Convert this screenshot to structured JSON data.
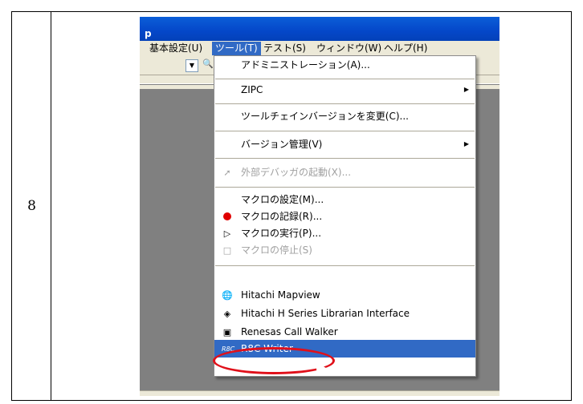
{
  "step_number": "8",
  "window": {
    "title_fragment": "p"
  },
  "menubar": [
    "基本設定(U)",
    "ツール(T)",
    "テスト(S)",
    "ウィンドウ(W)",
    "ヘルプ(H)"
  ],
  "tools_menu": {
    "administration": "アドミニストレーション(A)...",
    "zipc": "ZIPC",
    "toolchain": "ツールチェインバージョンを変更(C)...",
    "version_control": "バージョン管理(V)",
    "external_debugger": "外部デバッガの起動(X)...",
    "macro_settings": "マクロの設定(M)...",
    "macro_record": "マクロの記録(R)...",
    "macro_run": "マクロの実行(P)...",
    "macro_stop": "マクロの停止(S)",
    "hitachi_mapview": "Hitachi Mapview",
    "hitachi_librarian": "Hitachi H Series Librarian Interface",
    "call_walker": "Renesas Call Walker",
    "r8c_writer": "R8C Writer"
  },
  "colors": {
    "highlight": "#316ac5",
    "callout": "#e0101a",
    "titlebar": "#0447c9"
  }
}
